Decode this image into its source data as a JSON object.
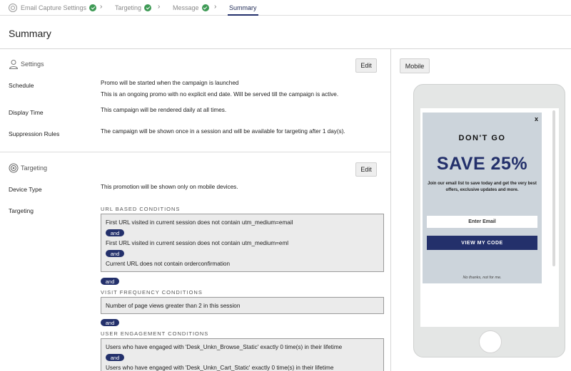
{
  "stepper": {
    "steps": [
      {
        "label": "Email Capture Settings",
        "complete": true
      },
      {
        "label": "Targeting",
        "complete": true
      },
      {
        "label": "Message",
        "complete": true
      },
      {
        "label": "Summary",
        "complete": false,
        "active": true
      }
    ]
  },
  "page": {
    "title": "Summary"
  },
  "settings": {
    "heading": "Settings",
    "edit_label": "Edit",
    "schedule": {
      "label": "Schedule",
      "line1": "Promo will be started when the campaign is launched",
      "line2": "This is an ongoing promo with no explicit end date. Will be served till the campaign is active."
    },
    "display_time": {
      "label": "Display Time",
      "text": "This campaign will be rendered daily at all times."
    },
    "suppression": {
      "label": "Suppression Rules",
      "text": "The campaign will be shown once in a session and will be available for targeting after 1 day(s)."
    }
  },
  "targeting": {
    "heading": "Targeting",
    "edit_label": "Edit",
    "device_type": {
      "label": "Device Type",
      "text": "This promotion will be shown only on mobile devices."
    },
    "targeting_label": "Targeting",
    "and_label": "and",
    "url_conditions": {
      "title": "URL BASED CONDITIONS",
      "items": [
        "First URL visited in current session does not contain utm_medium=email",
        "First URL visited in current session does not contain utm_medium=eml",
        "Current URL does not contain orderconfirmation"
      ]
    },
    "visit_conditions": {
      "title": "VISIT FREQUENCY CONDITIONS",
      "items": [
        "Number of page views greater than 2 in this session"
      ]
    },
    "engagement_conditions": {
      "title": "USER ENGAGEMENT CONDITIONS",
      "items": [
        "Users who have engaged with 'Desk_Unkn_Browse_Static' exactly 0 time(s) in their lifetime",
        "Users who have engaged with 'Desk_Unkn_Cart_Static' exactly 0 time(s) in their lifetime"
      ]
    }
  },
  "preview": {
    "mode_button": "Mobile",
    "popup": {
      "close": "x",
      "title": "DON'T GO",
      "headline": "SAVE 25%",
      "subtext": "Join our email list to save today and get the very best offers, exclusive updates and more.",
      "email_placeholder": "Enter Email",
      "cta": "VIEW MY CODE",
      "decline": "No thanks, not for me."
    }
  },
  "colors": {
    "accent": "#23306b",
    "success": "#3e9a55",
    "popup_bg": "#ccd4db"
  }
}
